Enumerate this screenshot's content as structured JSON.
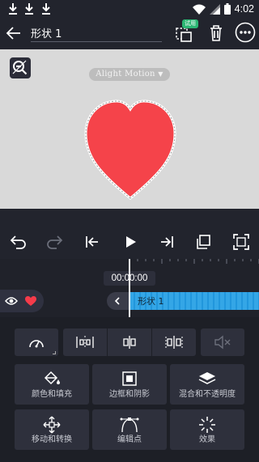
{
  "status_bar": {
    "time": "4:02",
    "icons": [
      "download-icon",
      "download-icon",
      "download-icon",
      "wifi-icon",
      "signal-icon",
      "battery-icon"
    ]
  },
  "toolbar": {
    "back_icon": "arrow-left-icon",
    "title": "形状 1",
    "trial_badge": "试用",
    "actions": [
      "duplicate-icon",
      "trash-icon",
      "more-icon"
    ]
  },
  "preview": {
    "watermark": "Alight Motion",
    "background_color": "#d9d9d9",
    "shape_color": "#f5434a",
    "shape": "heart"
  },
  "controls": [
    "undo-icon",
    "redo-icon",
    "skip-to-start-icon",
    "play-icon",
    "skip-to-end-icon",
    "copy-frame-icon",
    "fullscreen-icon"
  ],
  "timeline": {
    "timecode": "00:00:00",
    "layer_name": "形状 1",
    "clip_color": "#1f9ae0",
    "heart_color": "#f53b4a"
  },
  "panel": {
    "tiles": [
      {
        "label": "颜色和填充",
        "icon": "fill-bucket-icon"
      },
      {
        "label": "边框和阴影",
        "icon": "border-shadow-icon"
      },
      {
        "label": "混合和不透明度",
        "icon": "blend-layers-icon"
      },
      {
        "label": "移动和转换",
        "icon": "move-transform-icon"
      },
      {
        "label": "编辑点",
        "icon": "edit-points-icon"
      },
      {
        "label": "效果",
        "icon": "effects-icon"
      }
    ]
  }
}
